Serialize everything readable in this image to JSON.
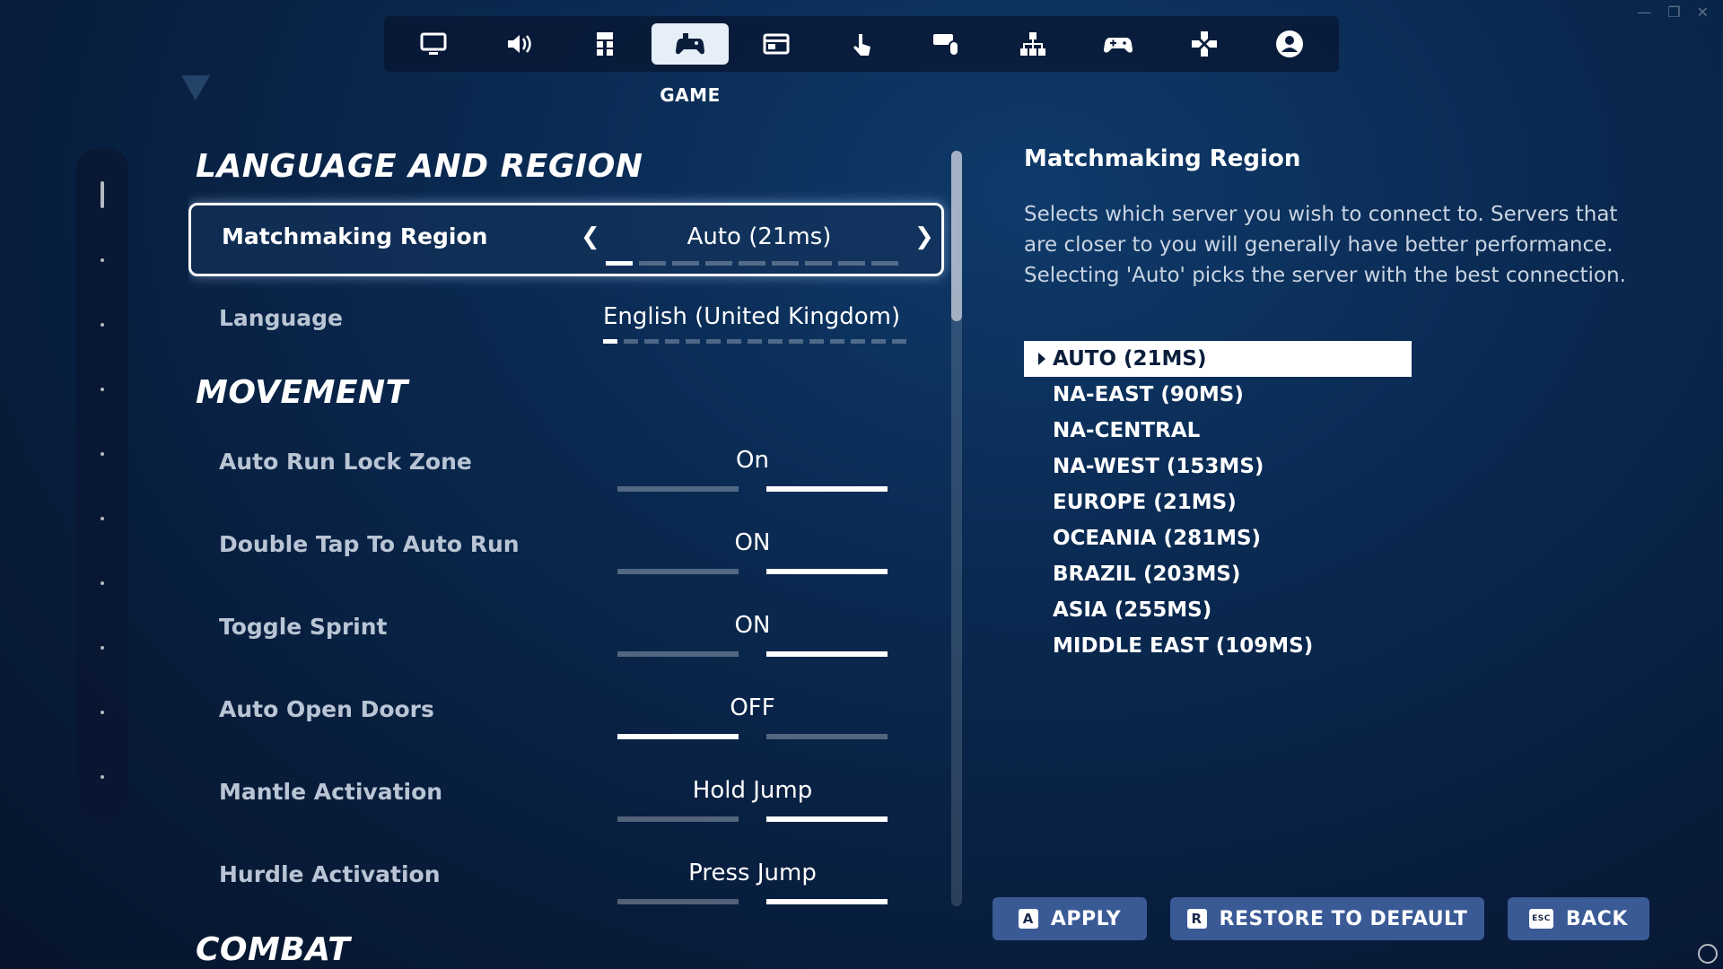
{
  "nav": {
    "tabs": [
      {
        "icon": "monitor-icon"
      },
      {
        "icon": "speaker-icon"
      },
      {
        "icon": "accessibility-icon"
      },
      {
        "icon": "game-controller-icon",
        "active": true
      },
      {
        "icon": "hud-icon"
      },
      {
        "icon": "touch-icon"
      },
      {
        "icon": "keyboard-mouse-icon"
      },
      {
        "icon": "network-icon"
      },
      {
        "icon": "gamepad-icon"
      },
      {
        "icon": "dpad-icon"
      },
      {
        "icon": "account-icon"
      }
    ],
    "active_label": "GAME"
  },
  "window": {
    "minimize": "—",
    "restore": "❐",
    "close": "✕"
  },
  "sections": {
    "language_region": "LANGUAGE AND REGION",
    "movement": "MOVEMENT",
    "combat": "COMBAT"
  },
  "settings": {
    "matchmaking_region": {
      "label": "Matchmaking Region",
      "value": "Auto (21ms)",
      "position": 1,
      "count": 9
    },
    "language": {
      "label": "Language",
      "value": "English (United Kingdom))",
      "position": 1,
      "count": 15
    },
    "auto_run_lock_zone": {
      "label": "Auto Run Lock Zone",
      "value": "On",
      "state": "on"
    },
    "double_tap_auto_run": {
      "label": "Double Tap To Auto Run",
      "value": "ON",
      "state": "on"
    },
    "toggle_sprint": {
      "label": "Toggle Sprint",
      "value": "ON",
      "state": "on"
    },
    "auto_open_doors": {
      "label": "Auto Open Doors",
      "value": "OFF",
      "state": "off"
    },
    "mantle_activation": {
      "label": "Mantle Activation",
      "value": "Hold Jump",
      "state": "on"
    },
    "hurdle_activation": {
      "label": "Hurdle Activation",
      "value": "Press Jump",
      "state": "on"
    }
  },
  "detail": {
    "title": "Matchmaking Region",
    "description": "Selects which server you wish to connect to. Servers that are closer to you will generally have better performance. Selecting 'Auto' picks the server with the best connection.",
    "options": [
      "AUTO (21MS)",
      "NA-EAST (90MS)",
      "NA-CENTRAL",
      "NA-WEST (153MS)",
      "EUROPE (21MS)",
      "OCEANIA (281MS)",
      "BRAZIL (203MS)",
      "ASIA (255MS)",
      "MIDDLE EAST (109MS)"
    ],
    "selected_index": 0
  },
  "buttons": {
    "apply": {
      "key": "A",
      "label": "APPLY"
    },
    "restore": {
      "key": "R",
      "label": "RESTORE TO DEFAULT"
    },
    "back": {
      "key": "ESC",
      "label": "BACK"
    }
  },
  "colors": {
    "accent_button": "#3a5a96",
    "background": "#0a2a52"
  }
}
